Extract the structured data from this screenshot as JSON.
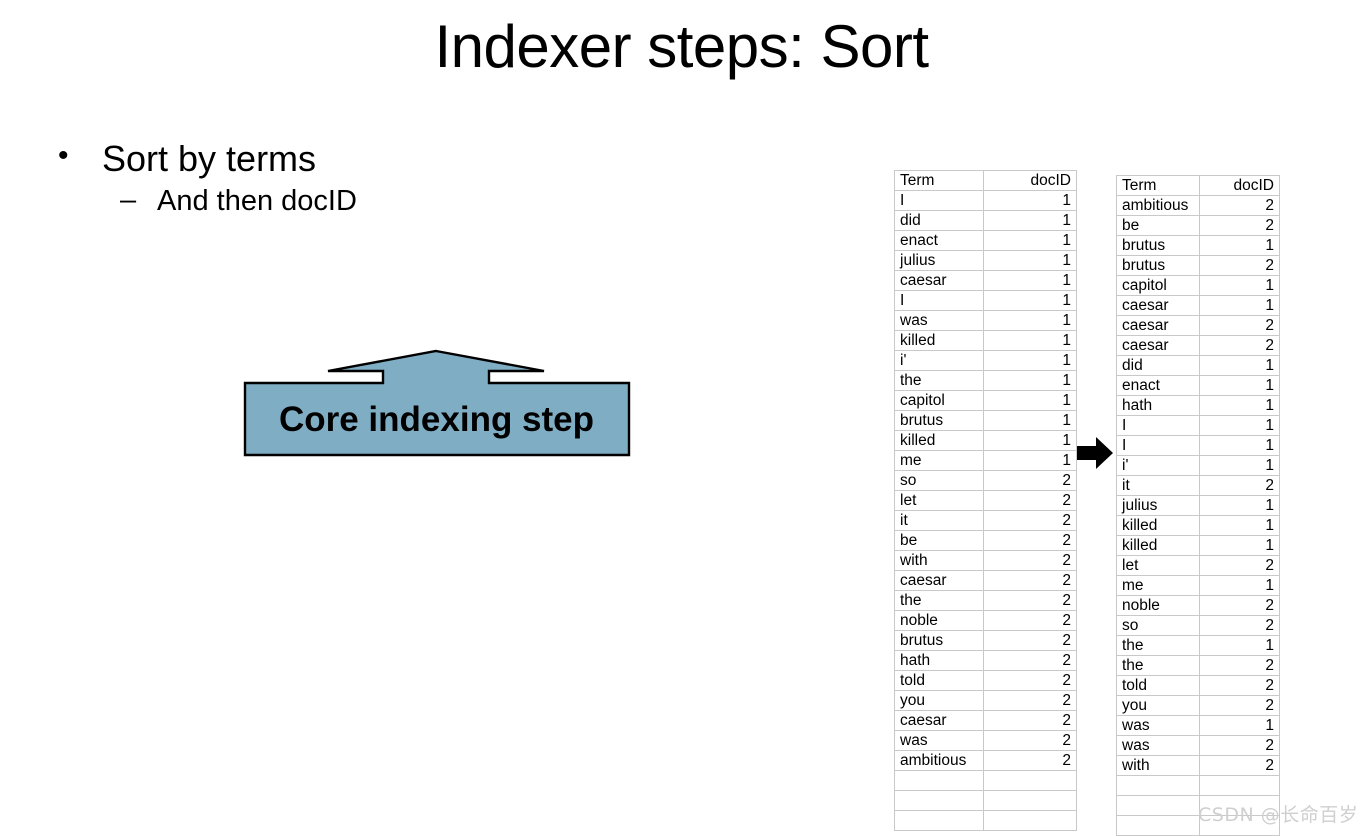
{
  "slide": {
    "title": "Indexer steps: Sort"
  },
  "bullets": {
    "level1_marker": "•",
    "level1_text": "Sort by terms",
    "level2_marker": "–",
    "level2_text": "And then docID"
  },
  "callout": {
    "label": "Core indexing step",
    "fill_color": "#7FAEC4",
    "stroke_color": "#000000"
  },
  "transition_arrow": {
    "color": "#000000",
    "direction": "right"
  },
  "watermark": {
    "text": "CSDN @长命百岁"
  },
  "tables": {
    "unsorted": {
      "headers": [
        "Term",
        "docID"
      ],
      "rows": [
        [
          "I",
          "1"
        ],
        [
          "did",
          "1"
        ],
        [
          "enact",
          "1"
        ],
        [
          "julius",
          "1"
        ],
        [
          "caesar",
          "1"
        ],
        [
          "I",
          "1"
        ],
        [
          "was",
          "1"
        ],
        [
          "killed",
          "1"
        ],
        [
          "i'",
          "1"
        ],
        [
          "the",
          "1"
        ],
        [
          "capitol",
          "1"
        ],
        [
          "brutus",
          "1"
        ],
        [
          "killed",
          "1"
        ],
        [
          "me",
          "1"
        ],
        [
          "so",
          "2"
        ],
        [
          "let",
          "2"
        ],
        [
          "it",
          "2"
        ],
        [
          "be",
          "2"
        ],
        [
          "with",
          "2"
        ],
        [
          "caesar",
          "2"
        ],
        [
          "the",
          "2"
        ],
        [
          "noble",
          "2"
        ],
        [
          "brutus",
          "2"
        ],
        [
          "hath",
          "2"
        ],
        [
          "told",
          "2"
        ],
        [
          "you",
          "2"
        ],
        [
          "caesar",
          "2"
        ],
        [
          "was",
          "2"
        ],
        [
          "ambitious",
          "2"
        ],
        [
          "",
          ""
        ],
        [
          "",
          ""
        ],
        [
          "",
          ""
        ]
      ]
    },
    "sorted": {
      "headers": [
        "Term",
        "docID"
      ],
      "rows": [
        [
          "ambitious",
          "2"
        ],
        [
          "be",
          "2"
        ],
        [
          "brutus",
          "1"
        ],
        [
          "brutus",
          "2"
        ],
        [
          "capitol",
          "1"
        ],
        [
          "caesar",
          "1"
        ],
        [
          "caesar",
          "2"
        ],
        [
          "caesar",
          "2"
        ],
        [
          "did",
          "1"
        ],
        [
          "enact",
          "1"
        ],
        [
          "hath",
          "1"
        ],
        [
          "I",
          "1"
        ],
        [
          "I",
          "1"
        ],
        [
          "i'",
          "1"
        ],
        [
          "it",
          "2"
        ],
        [
          "julius",
          "1"
        ],
        [
          "killed",
          "1"
        ],
        [
          "killed",
          "1"
        ],
        [
          "let",
          "2"
        ],
        [
          "me",
          "1"
        ],
        [
          "noble",
          "2"
        ],
        [
          "so",
          "2"
        ],
        [
          "the",
          "1"
        ],
        [
          "the",
          "2"
        ],
        [
          "told",
          "2"
        ],
        [
          "you",
          "2"
        ],
        [
          "was",
          "1"
        ],
        [
          "was",
          "2"
        ],
        [
          "with",
          "2"
        ],
        [
          "",
          ""
        ],
        [
          "",
          ""
        ],
        [
          "",
          ""
        ]
      ]
    }
  }
}
